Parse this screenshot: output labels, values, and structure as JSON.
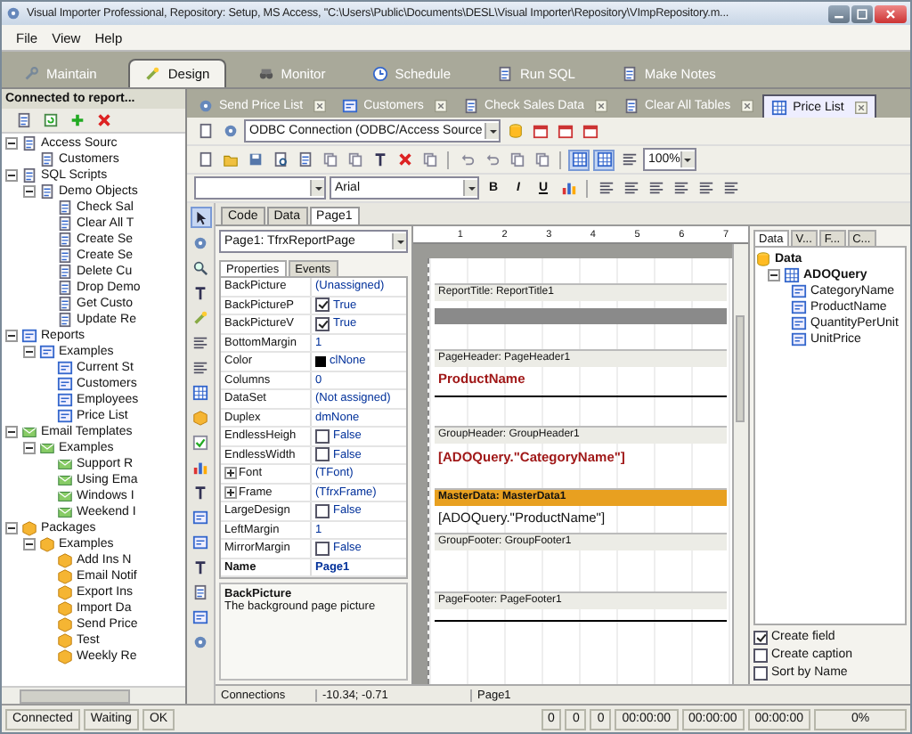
{
  "window": {
    "title": "Visual Importer Professional, Repository: Setup, MS Access, \"C:\\Users\\Public\\Documents\\DESL\\Visual Importer\\Repository\\VImpRepository.m..."
  },
  "menu": [
    "File",
    "View",
    "Help"
  ],
  "main_tabs": [
    {
      "label": "Maintain",
      "selected": false
    },
    {
      "label": "Design",
      "selected": true
    },
    {
      "label": "Monitor",
      "selected": false
    },
    {
      "label": "Schedule",
      "selected": false
    },
    {
      "label": "Run SQL",
      "selected": false
    },
    {
      "label": "Make Notes",
      "selected": false
    }
  ],
  "left_panel": {
    "title": "Connected to report...",
    "tree": [
      {
        "label": "Access Sourc",
        "kind": "source",
        "expanded": true,
        "children": [
          {
            "label": "Customers",
            "kind": "source"
          }
        ]
      },
      {
        "label": "SQL Scripts",
        "kind": "script",
        "expanded": true,
        "children": [
          {
            "label": "Demo Objects",
            "kind": "script",
            "expanded": true,
            "children": [
              {
                "label": "Check Sal",
                "kind": "script"
              },
              {
                "label": "Clear All T",
                "kind": "script"
              },
              {
                "label": "Create Se",
                "kind": "script"
              },
              {
                "label": "Create Se",
                "kind": "script"
              },
              {
                "label": "Delete Cu",
                "kind": "script"
              },
              {
                "label": "Drop Demo",
                "kind": "script"
              },
              {
                "label": "Get Custo",
                "kind": "script"
              },
              {
                "label": "Update Re",
                "kind": "script"
              }
            ]
          }
        ]
      },
      {
        "label": "Reports",
        "kind": "report",
        "expanded": true,
        "children": [
          {
            "label": "Examples",
            "kind": "report",
            "expanded": true,
            "children": [
              {
                "label": "Current St",
                "kind": "report"
              },
              {
                "label": "Customers",
                "kind": "report"
              },
              {
                "label": "Employees",
                "kind": "report"
              },
              {
                "label": "Price List",
                "kind": "report"
              }
            ]
          }
        ]
      },
      {
        "label": "Email Templates",
        "kind": "email",
        "expanded": true,
        "children": [
          {
            "label": "Examples",
            "kind": "email",
            "expanded": true,
            "children": [
              {
                "label": "Support R",
                "kind": "email"
              },
              {
                "label": "Using Ema",
                "kind": "email"
              },
              {
                "label": "Windows I",
                "kind": "email"
              },
              {
                "label": "Weekend I",
                "kind": "email"
              }
            ]
          }
        ]
      },
      {
        "label": "Packages",
        "kind": "package",
        "expanded": true,
        "children": [
          {
            "label": "Examples",
            "kind": "package",
            "expanded": true,
            "children": [
              {
                "label": "Add Ins N",
                "kind": "package"
              },
              {
                "label": "Email Notif",
                "kind": "package"
              },
              {
                "label": "Export Ins",
                "kind": "package"
              },
              {
                "label": "Import Da",
                "kind": "package"
              },
              {
                "label": "Send Price",
                "kind": "package"
              },
              {
                "label": "Test",
                "kind": "package"
              },
              {
                "label": "Weekly Re",
                "kind": "package"
              }
            ]
          }
        ]
      }
    ]
  },
  "doc_tabs": [
    {
      "label": "Send Price List",
      "selected": false
    },
    {
      "label": "Customers",
      "selected": false
    },
    {
      "label": "Check Sales Data",
      "selected": false
    },
    {
      "label": "Clear All Tables",
      "selected": false
    },
    {
      "label": "Price List",
      "selected": true
    }
  ],
  "toolbar": {
    "connection": "ODBC Connection (ODBC/Access Source",
    "zoom": "100%",
    "font": "Arial",
    "format_buttons": [
      "B",
      "I",
      "U"
    ]
  },
  "designer_tabs": [
    {
      "label": "Code",
      "selected": false
    },
    {
      "label": "Data",
      "selected": false
    },
    {
      "label": "Page1",
      "selected": true
    }
  ],
  "ruler_marks": [
    "1",
    "2",
    "3",
    "4",
    "5",
    "6",
    "7"
  ],
  "inspector": {
    "object": "Page1: TfrxReportPage",
    "tabs": [
      {
        "label": "Properties",
        "selected": true
      },
      {
        "label": "Events",
        "selected": false
      }
    ],
    "properties": [
      {
        "name": "BackPicture",
        "value": "(Unassigned)",
        "kind": "text"
      },
      {
        "name": "BackPictureP",
        "value": "True",
        "kind": "check",
        "checked": true
      },
      {
        "name": "BackPictureV",
        "value": "True",
        "kind": "check",
        "checked": true
      },
      {
        "name": "BottomMargin",
        "value": "1",
        "kind": "text"
      },
      {
        "name": "Color",
        "value": "clNone",
        "kind": "color",
        "color": "#000000"
      },
      {
        "name": "Columns",
        "value": "0",
        "kind": "text"
      },
      {
        "name": "DataSet",
        "value": "(Not assigned)",
        "kind": "text"
      },
      {
        "name": "Duplex",
        "value": "dmNone",
        "kind": "text"
      },
      {
        "name": "EndlessHeigh",
        "value": "False",
        "kind": "check",
        "checked": false
      },
      {
        "name": "EndlessWidth",
        "value": "False",
        "kind": "check",
        "checked": false
      },
      {
        "name": "Font",
        "value": "(TFont)",
        "kind": "group",
        "expanded": false
      },
      {
        "name": "Frame",
        "value": "(TfrxFrame)",
        "kind": "group",
        "expanded": false
      },
      {
        "name": "LargeDesign",
        "value": "False",
        "kind": "check",
        "checked": false
      },
      {
        "name": "LeftMargin",
        "value": "1",
        "kind": "text"
      },
      {
        "name": "MirrorMargin",
        "value": "False",
        "kind": "check",
        "checked": false
      },
      {
        "name": "Name",
        "value": "Page1",
        "kind": "bold"
      }
    ],
    "help_title": "BackPicture",
    "help_text": "The background page picture"
  },
  "bands": [
    {
      "kind": "title",
      "caption": "ReportTitle: ReportTitle1"
    },
    {
      "kind": "page_header",
      "caption": "PageHeader: PageHeader1",
      "text": "ProductName"
    },
    {
      "kind": "group_header",
      "caption": "GroupHeader: GroupHeader1",
      "text": "[ADOQuery.\"CategoryName\"]"
    },
    {
      "kind": "master_data",
      "caption": "MasterData: MasterData1",
      "text": "[ADOQuery.\"ProductName\"]"
    },
    {
      "kind": "group_footer",
      "caption": "GroupFooter: GroupFooter1"
    },
    {
      "kind": "page_footer",
      "caption": "PageFooter: PageFooter1"
    }
  ],
  "data_panel": {
    "tabs": [
      {
        "label": "Data",
        "selected": true
      },
      {
        "label": "V...",
        "selected": false
      },
      {
        "label": "F...",
        "selected": false
      },
      {
        "label": "C...",
        "selected": false
      }
    ],
    "root": "Data",
    "query": {
      "label": "ADOQuery",
      "expanded": true
    },
    "fields": [
      "CategoryName",
      "ProductName",
      "QuantityPerUnit",
      "UnitPrice"
    ],
    "options": [
      {
        "label": "Create field",
        "checked": true
      },
      {
        "label": "Create caption",
        "checked": false
      },
      {
        "label": "Sort by Name",
        "checked": false
      }
    ]
  },
  "designer_status": {
    "section": "Connections",
    "coords": "-10.34; -0.71",
    "page": "Page1"
  },
  "status_bar": [
    "Connected",
    "Waiting",
    "OK"
  ],
  "status_counters": [
    "0",
    "0",
    "0",
    "00:00:00",
    "00:00:00",
    "00:00:00"
  ],
  "progress": {
    "text": "0%"
  }
}
